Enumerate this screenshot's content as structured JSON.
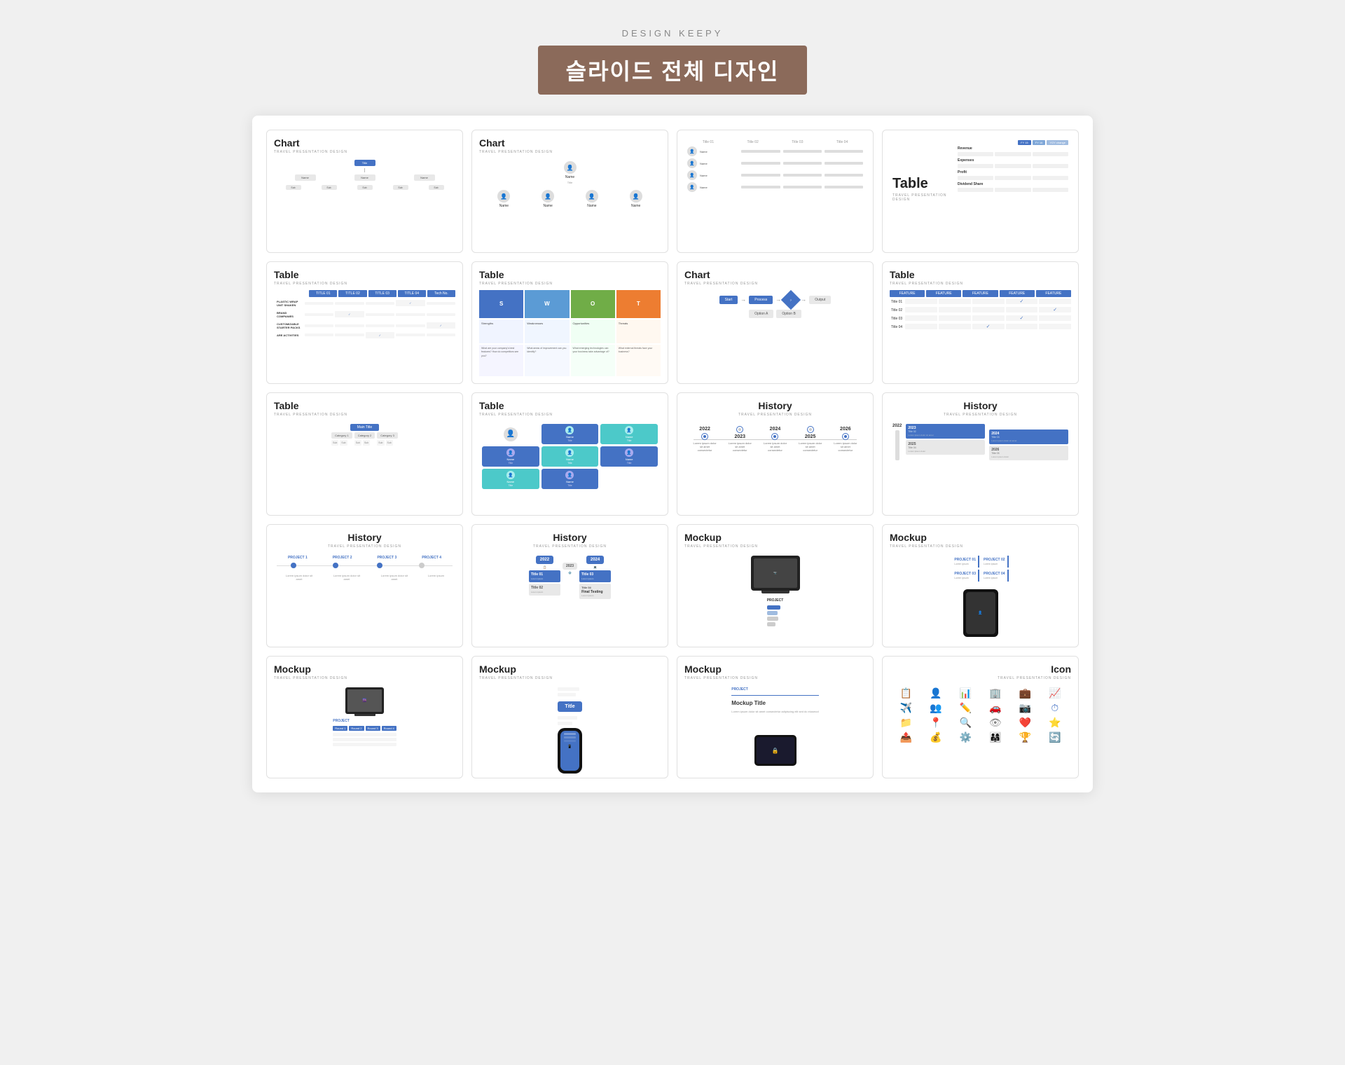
{
  "brand": {
    "label": "DESIGN KEEPY",
    "title": "슬라이드 전체 디자인"
  },
  "slides": [
    {
      "id": "slide-01",
      "type": "chart-org",
      "title": "Chart",
      "subtitle": "TRAVEL PRESENTATION DESIGN",
      "desc": "Organizational hierarchy chart with blue and gray boxes"
    },
    {
      "id": "slide-02",
      "type": "chart-person",
      "title": "Chart",
      "subtitle": "TRAVEL PRESENTATION DESIGN",
      "desc": "Person/team chart with profile cards"
    },
    {
      "id": "slide-03",
      "type": "table-profile",
      "title": "",
      "subtitle": "",
      "desc": "Profile table with avatar rows and multiple columns"
    },
    {
      "id": "slide-04",
      "type": "table-finance",
      "title": "Table",
      "subtitle": "TRAVEL PRESENTATION DESIGN",
      "desc": "Financial table with revenue/expenses/profit/dividend"
    },
    {
      "id": "slide-05",
      "type": "table-check",
      "title": "Table",
      "subtitle": "TRAVEL PRESENTATION DESIGN",
      "desc": "Feature comparison table with checkmarks"
    },
    {
      "id": "slide-06",
      "type": "table-swot",
      "title": "Table",
      "subtitle": "TRAVEL PRESENTATION DESIGN",
      "desc": "SWOT analysis table S W O T"
    },
    {
      "id": "slide-07",
      "type": "chart-flow",
      "title": "Chart",
      "subtitle": "TRAVEL PRESENTATION DESIGN",
      "desc": "Flowchart with diamond shapes and arrows"
    },
    {
      "id": "slide-08",
      "type": "table-feature",
      "title": "Table",
      "subtitle": "TRAVEL PRESENTATION DESIGN",
      "desc": "Feature table with 5 feature columns"
    },
    {
      "id": "slide-09",
      "type": "table-hierarchy",
      "title": "Table",
      "subtitle": "TRAVEL PRESENTATION DESIGN",
      "desc": "Hierarchical table with nested boxes"
    },
    {
      "id": "slide-10",
      "type": "table-person-cards",
      "title": "Table",
      "subtitle": "TRAVEL PRESENTATION DESIGN",
      "desc": "Person cards table with teal and blue cards"
    },
    {
      "id": "slide-11",
      "type": "history-timeline",
      "title": "History",
      "subtitle": "TRAVEL PRESENTATION DESIGN",
      "desc": "Horizontal timeline 2022 2023 2024 2025 2026",
      "years": [
        "2022",
        "2023",
        "2024",
        "2025",
        "2026"
      ]
    },
    {
      "id": "slide-12",
      "type": "history-vert",
      "title": "History",
      "subtitle": "TRAVEL PRESENTATION DESIGN",
      "desc": "Vertical timeline with blue dots 2022 2023 2024 2025 2026",
      "years": [
        "2022",
        "2023",
        "2024",
        "2025",
        "2026"
      ]
    },
    {
      "id": "slide-13",
      "type": "history-projects",
      "title": "History",
      "subtitle": "TRAVEL PRESENTATION DESIGN",
      "desc": "Project timeline with 4 projects",
      "projects": [
        "PROJECT 1",
        "PROJECT 2",
        "PROJECT 3",
        "PROJECT 4"
      ]
    },
    {
      "id": "slide-14",
      "type": "history-connected",
      "title": "History",
      "subtitle": "TRAVEL PRESENTATION DESIGN",
      "desc": "Connected history 2022 2023 2024 with icons",
      "items": [
        "Title 01",
        "Title 02",
        "Title 03",
        "Title 04",
        "Final Testing"
      ]
    },
    {
      "id": "slide-15",
      "type": "mockup-monitor",
      "title": "Mockup",
      "subtitle": "TRAVEL PRESENTATION DESIGN",
      "desc": "Monitor mockup with project section"
    },
    {
      "id": "slide-16",
      "type": "mockup-tablet-right",
      "title": "Mockup",
      "subtitle": "TRAVEL PRESENTATION DESIGN",
      "desc": "Mockup with project grid and tablet on right",
      "projects": [
        "PROJECT 01",
        "PROJECT 02",
        "PROJECT 03",
        "PROJECT 04"
      ]
    },
    {
      "id": "slide-17",
      "type": "mockup-monitor-left",
      "title": "Mockup",
      "subtitle": "TRAVEL PRESENTATION DESIGN",
      "desc": "Mockup with monitor on left and project table"
    },
    {
      "id": "slide-18",
      "type": "mockup-phone",
      "title": "Mockup",
      "subtitle": "TRAVEL PRESENTATION DESIGN",
      "desc": "Phone mockup with title block and connection lines"
    },
    {
      "id": "slide-19",
      "type": "mockup-title",
      "title": "Mockup",
      "subtitle": "TRAVEL PRESENTATION DESIGN",
      "desc": "Mockup title slide with PROJECT label and tablet"
    },
    {
      "id": "slide-20",
      "type": "icon-grid",
      "title": "Icon",
      "subtitle": "TRAVEL PRESENTATION DESIGN",
      "desc": "Icon grid with various UI icons in blue and outline styles"
    }
  ],
  "colors": {
    "blue": "#4472C4",
    "brown": "#8B6A5A",
    "gray": "#e0e0e0",
    "teal": "#4CC9C9",
    "light_blue": "#5B9BD5"
  }
}
